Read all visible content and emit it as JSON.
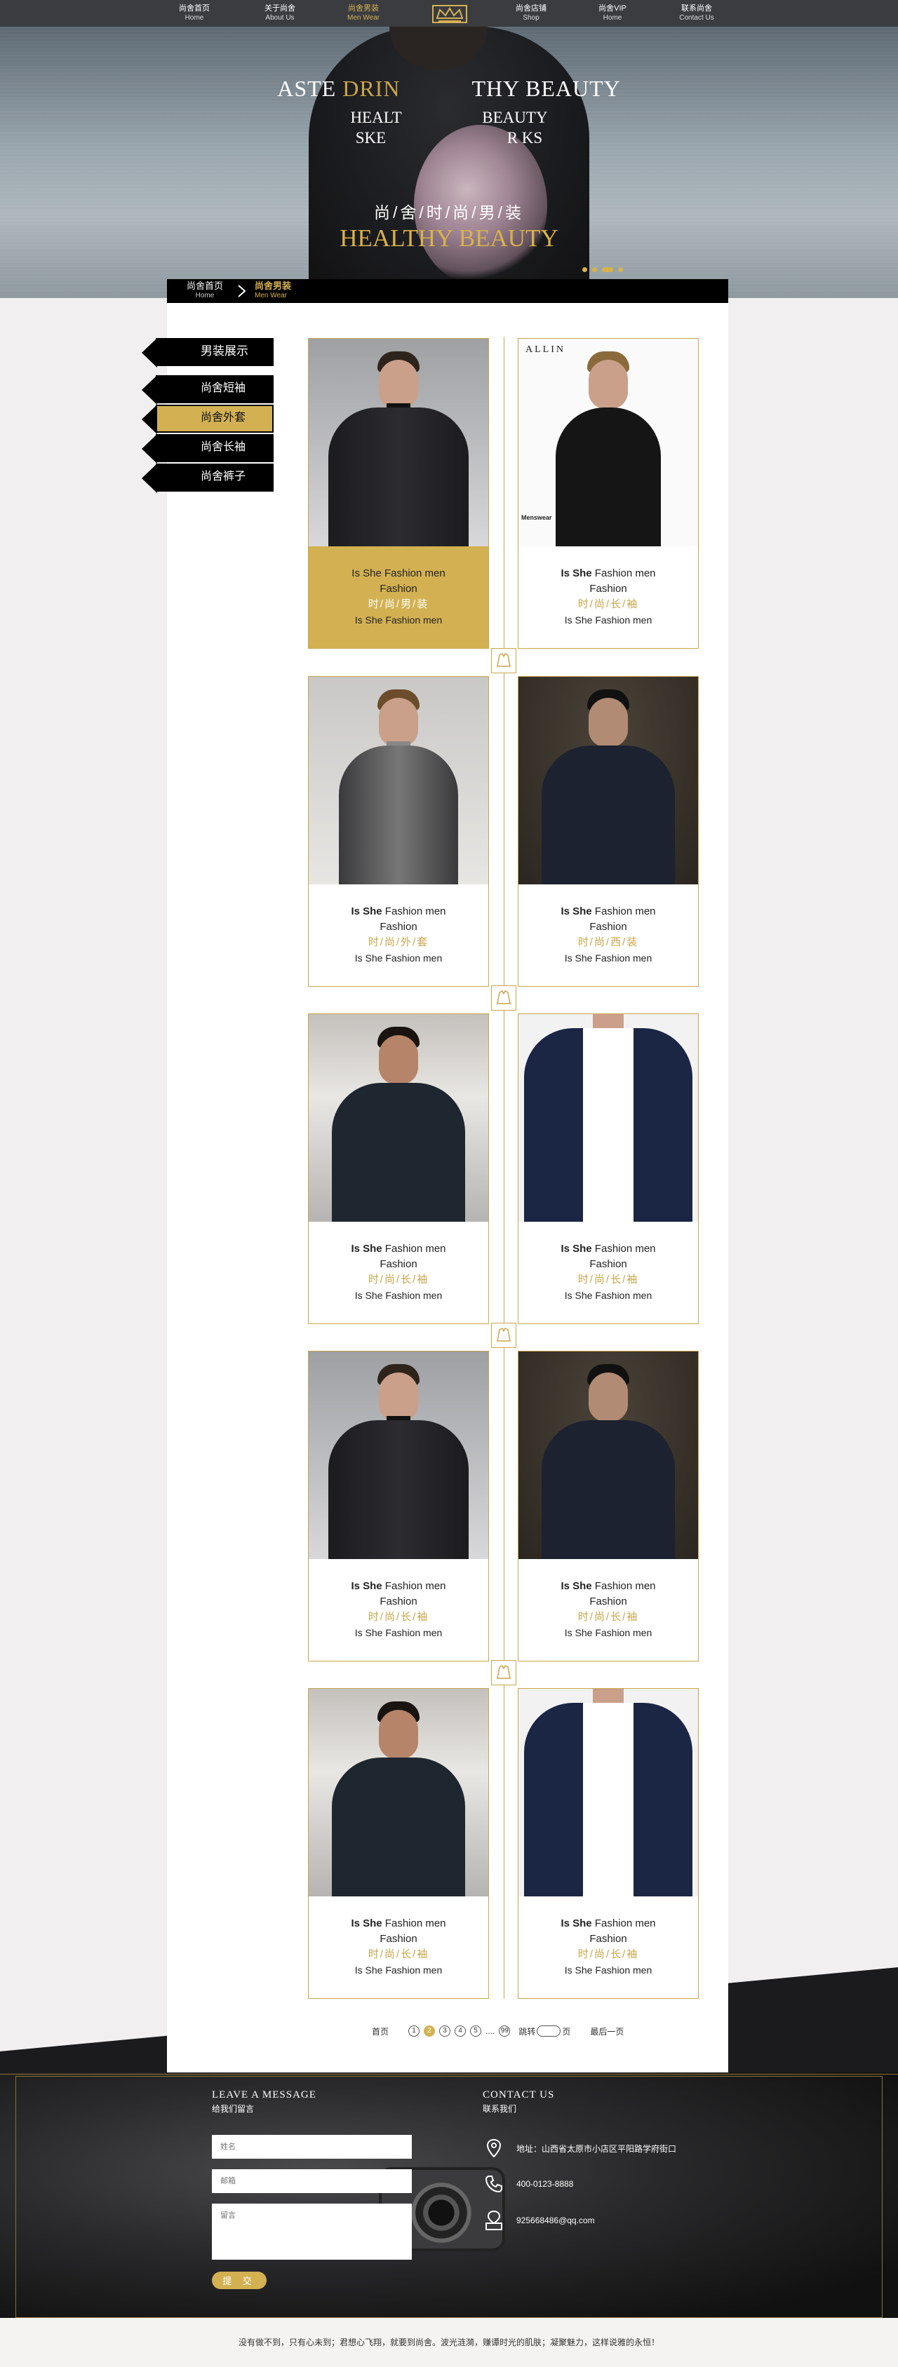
{
  "nav": {
    "items": [
      {
        "cn": "尚舍首页",
        "en": "Home"
      },
      {
        "cn": "关于尚舍",
        "en": "About Us"
      },
      {
        "cn": "尚舍男装",
        "en": "Men Wear"
      },
      {
        "cn": "尚舍店铺",
        "en": "Shop"
      },
      {
        "cn": "尚舍VIP",
        "en": "Home"
      },
      {
        "cn": "联系尚舍",
        "en": "Contact Us"
      }
    ],
    "active_index": 2,
    "logo_icon": "crown-logo-icon"
  },
  "hero": {
    "line1a": "ASTE ",
    "line1b": "DRIN",
    "line1c": "THY BEAUTY",
    "line2": "HEALT                    BEAUTY",
    "line3": "SKE                              R KS",
    "line4": "尚/舍/时/尚/男/装",
    "line5": "HEALTHY BEAUTY",
    "slides": 4,
    "active_slide": 3
  },
  "breadcrumb": {
    "home_cn": "尚舍首页",
    "home_en": "Home",
    "current_cn": "尚舍男装",
    "current_en": "Men Wear"
  },
  "sidebar": {
    "items": [
      "男装展示",
      "尚舍短袖",
      "尚舍外套",
      "尚舍长袖",
      "尚舍裤子"
    ],
    "active_index": 2
  },
  "products": [
    {
      "l1": "Is She Fashion men",
      "l2": "Fashion",
      "l3": "时/尚/男/装",
      "l4": "Is She Fashion men",
      "highlight": true
    },
    {
      "l1": "Is She Fashion men",
      "l2": "Fashion",
      "l3": "时/尚/长/袖",
      "l4": "Is She Fashion men"
    },
    {
      "l1": "Is She Fashion men",
      "l2": "Fashion",
      "l3": "时/尚/外/套",
      "l4": "Is She Fashion men"
    },
    {
      "l1": "Is She Fashion men",
      "l2": "Fashion",
      "l3": "时/尚/西/装",
      "l4": "Is She Fashion men"
    },
    {
      "l1": "Is She Fashion men",
      "l2": "Fashion",
      "l3": "时/尚/长/袖",
      "l4": "Is She Fashion men"
    },
    {
      "l1": "Is She Fashion men",
      "l2": "Fashion",
      "l3": "时/尚/长/袖",
      "l4": "Is She Fashion men"
    },
    {
      "l1": "Is She Fashion men",
      "l2": "Fashion",
      "l3": "时/尚/长/袖",
      "l4": "Is She Fashion men"
    },
    {
      "l1": "Is She Fashion men",
      "l2": "Fashion",
      "l3": "时/尚/长/袖",
      "l4": "Is She Fashion men"
    },
    {
      "l1": "Is She Fashion men",
      "l2": "Fashion",
      "l3": "时/尚/长/袖",
      "l4": "Is She Fashion men"
    },
    {
      "l1": "Is She Fashion men",
      "l2": "Fashion",
      "l3": "时/尚/长/袖",
      "l4": "Is She Fashion men"
    }
  ],
  "product_photo_text": {
    "allin": "ALLIN",
    "menswear": "Menswear"
  },
  "pagination": {
    "first": "首页",
    "pages": [
      "1",
      "2",
      "3",
      "4",
      "5"
    ],
    "current": "2",
    "ellipsis": "....",
    "last_page": "99",
    "jump": "跳转",
    "page_unit": "页",
    "last": "最后一页"
  },
  "footer": {
    "message_title": "LEAVE A MESSAGE",
    "message_sub": "给我们留言",
    "name_placeholder": "姓名",
    "phone_placeholder": "邮箱",
    "msg_placeholder": "留言",
    "submit": "提 交",
    "contact_title": "CONTACT US",
    "contact_sub": "联系我们",
    "address": "地址：山西省太原市小店区平阳路学府街口",
    "phone": "400-0123-8888",
    "email": "925668486@qq.com"
  },
  "slogan": "没有做不到，只有心未到；君想心飞翔，就要到尚舍。波光涟漪，赚谭时光的肌肤；凝聚魅力，这样说雅的永恒！",
  "colors": {
    "gold": "#d3b152",
    "dark": "#3a3c40"
  }
}
